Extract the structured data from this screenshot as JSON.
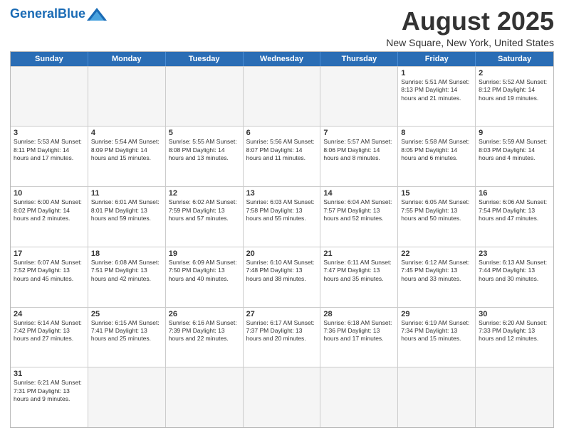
{
  "header": {
    "logo_general": "General",
    "logo_blue": "Blue",
    "title": "August 2025",
    "subtitle": "New Square, New York, United States"
  },
  "weekdays": [
    "Sunday",
    "Monday",
    "Tuesday",
    "Wednesday",
    "Thursday",
    "Friday",
    "Saturday"
  ],
  "weeks": [
    [
      {
        "day": "",
        "info": "",
        "empty": true
      },
      {
        "day": "",
        "info": "",
        "empty": true
      },
      {
        "day": "",
        "info": "",
        "empty": true
      },
      {
        "day": "",
        "info": "",
        "empty": true
      },
      {
        "day": "",
        "info": "",
        "empty": true
      },
      {
        "day": "1",
        "info": "Sunrise: 5:51 AM\nSunset: 8:13 PM\nDaylight: 14 hours\nand 21 minutes."
      },
      {
        "day": "2",
        "info": "Sunrise: 5:52 AM\nSunset: 8:12 PM\nDaylight: 14 hours\nand 19 minutes."
      }
    ],
    [
      {
        "day": "3",
        "info": "Sunrise: 5:53 AM\nSunset: 8:11 PM\nDaylight: 14 hours\nand 17 minutes."
      },
      {
        "day": "4",
        "info": "Sunrise: 5:54 AM\nSunset: 8:09 PM\nDaylight: 14 hours\nand 15 minutes."
      },
      {
        "day": "5",
        "info": "Sunrise: 5:55 AM\nSunset: 8:08 PM\nDaylight: 14 hours\nand 13 minutes."
      },
      {
        "day": "6",
        "info": "Sunrise: 5:56 AM\nSunset: 8:07 PM\nDaylight: 14 hours\nand 11 minutes."
      },
      {
        "day": "7",
        "info": "Sunrise: 5:57 AM\nSunset: 8:06 PM\nDaylight: 14 hours\nand 8 minutes."
      },
      {
        "day": "8",
        "info": "Sunrise: 5:58 AM\nSunset: 8:05 PM\nDaylight: 14 hours\nand 6 minutes."
      },
      {
        "day": "9",
        "info": "Sunrise: 5:59 AM\nSunset: 8:03 PM\nDaylight: 14 hours\nand 4 minutes."
      }
    ],
    [
      {
        "day": "10",
        "info": "Sunrise: 6:00 AM\nSunset: 8:02 PM\nDaylight: 14 hours\nand 2 minutes."
      },
      {
        "day": "11",
        "info": "Sunrise: 6:01 AM\nSunset: 8:01 PM\nDaylight: 13 hours\nand 59 minutes."
      },
      {
        "day": "12",
        "info": "Sunrise: 6:02 AM\nSunset: 7:59 PM\nDaylight: 13 hours\nand 57 minutes."
      },
      {
        "day": "13",
        "info": "Sunrise: 6:03 AM\nSunset: 7:58 PM\nDaylight: 13 hours\nand 55 minutes."
      },
      {
        "day": "14",
        "info": "Sunrise: 6:04 AM\nSunset: 7:57 PM\nDaylight: 13 hours\nand 52 minutes."
      },
      {
        "day": "15",
        "info": "Sunrise: 6:05 AM\nSunset: 7:55 PM\nDaylight: 13 hours\nand 50 minutes."
      },
      {
        "day": "16",
        "info": "Sunrise: 6:06 AM\nSunset: 7:54 PM\nDaylight: 13 hours\nand 47 minutes."
      }
    ],
    [
      {
        "day": "17",
        "info": "Sunrise: 6:07 AM\nSunset: 7:52 PM\nDaylight: 13 hours\nand 45 minutes."
      },
      {
        "day": "18",
        "info": "Sunrise: 6:08 AM\nSunset: 7:51 PM\nDaylight: 13 hours\nand 42 minutes."
      },
      {
        "day": "19",
        "info": "Sunrise: 6:09 AM\nSunset: 7:50 PM\nDaylight: 13 hours\nand 40 minutes."
      },
      {
        "day": "20",
        "info": "Sunrise: 6:10 AM\nSunset: 7:48 PM\nDaylight: 13 hours\nand 38 minutes."
      },
      {
        "day": "21",
        "info": "Sunrise: 6:11 AM\nSunset: 7:47 PM\nDaylight: 13 hours\nand 35 minutes."
      },
      {
        "day": "22",
        "info": "Sunrise: 6:12 AM\nSunset: 7:45 PM\nDaylight: 13 hours\nand 33 minutes."
      },
      {
        "day": "23",
        "info": "Sunrise: 6:13 AM\nSunset: 7:44 PM\nDaylight: 13 hours\nand 30 minutes."
      }
    ],
    [
      {
        "day": "24",
        "info": "Sunrise: 6:14 AM\nSunset: 7:42 PM\nDaylight: 13 hours\nand 27 minutes."
      },
      {
        "day": "25",
        "info": "Sunrise: 6:15 AM\nSunset: 7:41 PM\nDaylight: 13 hours\nand 25 minutes."
      },
      {
        "day": "26",
        "info": "Sunrise: 6:16 AM\nSunset: 7:39 PM\nDaylight: 13 hours\nand 22 minutes."
      },
      {
        "day": "27",
        "info": "Sunrise: 6:17 AM\nSunset: 7:37 PM\nDaylight: 13 hours\nand 20 minutes."
      },
      {
        "day": "28",
        "info": "Sunrise: 6:18 AM\nSunset: 7:36 PM\nDaylight: 13 hours\nand 17 minutes."
      },
      {
        "day": "29",
        "info": "Sunrise: 6:19 AM\nSunset: 7:34 PM\nDaylight: 13 hours\nand 15 minutes."
      },
      {
        "day": "30",
        "info": "Sunrise: 6:20 AM\nSunset: 7:33 PM\nDaylight: 13 hours\nand 12 minutes."
      }
    ],
    [
      {
        "day": "31",
        "info": "Sunrise: 6:21 AM\nSunset: 7:31 PM\nDaylight: 13 hours\nand 9 minutes."
      },
      {
        "day": "",
        "info": "",
        "empty": true
      },
      {
        "day": "",
        "info": "",
        "empty": true
      },
      {
        "day": "",
        "info": "",
        "empty": true
      },
      {
        "day": "",
        "info": "",
        "empty": true
      },
      {
        "day": "",
        "info": "",
        "empty": true
      },
      {
        "day": "",
        "info": "",
        "empty": true
      }
    ]
  ]
}
